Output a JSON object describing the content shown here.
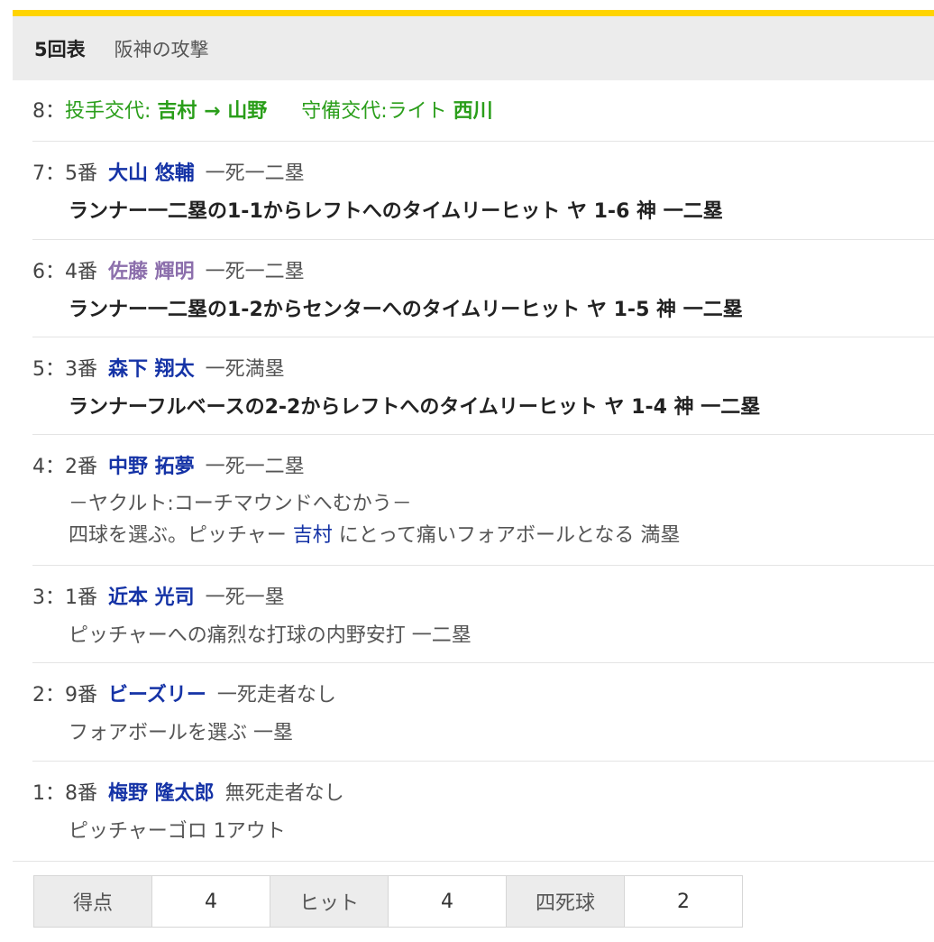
{
  "colors": {
    "accent_bar": "#ffd400",
    "header_bg": "#ececec",
    "player_link": "#1533a6",
    "player_highlight": "#8c6fac",
    "change_text": "#2a9e1a"
  },
  "inning": {
    "number": "5回表",
    "team_attack": "阪神の攻撃"
  },
  "plays": [
    {
      "seq": "8：",
      "change_label": "投手交代: ",
      "pitcher_from": "吉村",
      "arrow": " → ",
      "pitcher_to": "山野",
      "def_label": "守備交代:ライト ",
      "def_player": "西川"
    },
    {
      "seq": "7：",
      "order": "5番",
      "name": "大山 悠輔",
      "situation": "一死一二塁",
      "result": "ランナー一二塁の1-1からレフトへのタイムリーヒット ヤ 1-6 神 一二塁"
    },
    {
      "seq": "6：",
      "order": "4番",
      "name": "佐藤 輝明",
      "situation": "一死一二塁",
      "result": "ランナー一二塁の1-2からセンターへのタイムリーヒット ヤ 1-5 神 一二塁"
    },
    {
      "seq": "5：",
      "order": "3番",
      "name": "森下 翔太",
      "situation": "一死満塁",
      "result": "ランナーフルベースの2-2からレフトへのタイムリーヒット ヤ 1-4 神 一二塁"
    },
    {
      "seq": "4：",
      "order": "2番",
      "name": "中野 拓夢",
      "situation": "一死一二塁",
      "note": "－ヤクルト:コーチマウンドへむかう－",
      "result_pre": "四球を選ぶ。ピッチャー ",
      "result_pitcher": "吉村",
      "result_post": "  にとって痛いフォアボールとなる 満塁"
    },
    {
      "seq": "3：",
      "order": "1番",
      "name": "近本 光司",
      "situation": "一死一塁",
      "result": "ピッチャーへの痛烈な打球の内野安打 一二塁"
    },
    {
      "seq": "2：",
      "order": "9番",
      "name": "ビーズリー",
      "situation": "一死走者なし",
      "result": "フォアボールを選ぶ 一塁"
    },
    {
      "seq": "1：",
      "order": "8番",
      "name": "梅野 隆太郎",
      "situation": "無死走者なし",
      "result": "ピッチャーゴロ 1アウト"
    }
  ],
  "summary": {
    "runs_label": "得点",
    "runs": "4",
    "hits_label": "ヒット",
    "hits": "4",
    "walks_label": "四死球",
    "walks": "2"
  }
}
